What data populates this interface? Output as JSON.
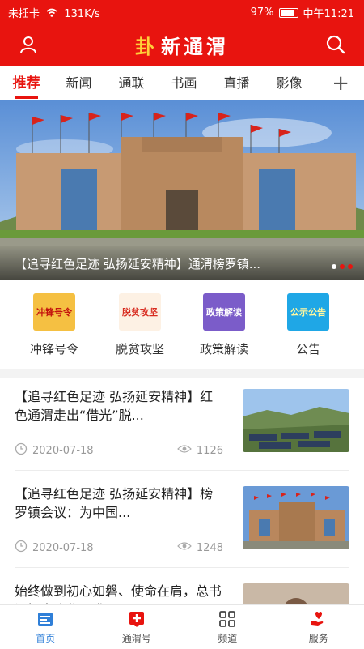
{
  "status": {
    "carrier": "未插卡",
    "speed": "131K/s",
    "battery": "97%",
    "time": "中午11:21"
  },
  "header": {
    "logo": "新通渭"
  },
  "tabs": [
    "推荐",
    "新闻",
    "通联",
    "书画",
    "直播",
    "影像"
  ],
  "banner": {
    "caption": "【追寻红色足迹 弘扬延安精神】通渭榜罗镇..."
  },
  "shortcuts": [
    {
      "label": "冲锋号令",
      "tile": "冲锋号令"
    },
    {
      "label": "脱贫攻坚",
      "tile": "脱贫攻坚"
    },
    {
      "label": "政策解读",
      "tile": "政策解读"
    },
    {
      "label": "公告",
      "tile": "公示公告"
    }
  ],
  "news": [
    {
      "title": "【追寻红色足迹 弘扬延安精神】红色通渭走出“借光”脱...",
      "date": "2020-07-18",
      "views": "1126"
    },
    {
      "title": "【追寻红色足迹 弘扬延安精神】榜罗镇会议：为中国...",
      "date": "2020-07-18",
      "views": "1248"
    },
    {
      "title": "始终做到初心如磐、使命在肩，总书记提出这些要求！"
    }
  ],
  "bottom_nav": [
    "首页",
    "通渭号",
    "频道",
    "服务"
  ],
  "colors": {
    "brand": "#e8140f",
    "active_nav": "#2f7fd8"
  }
}
